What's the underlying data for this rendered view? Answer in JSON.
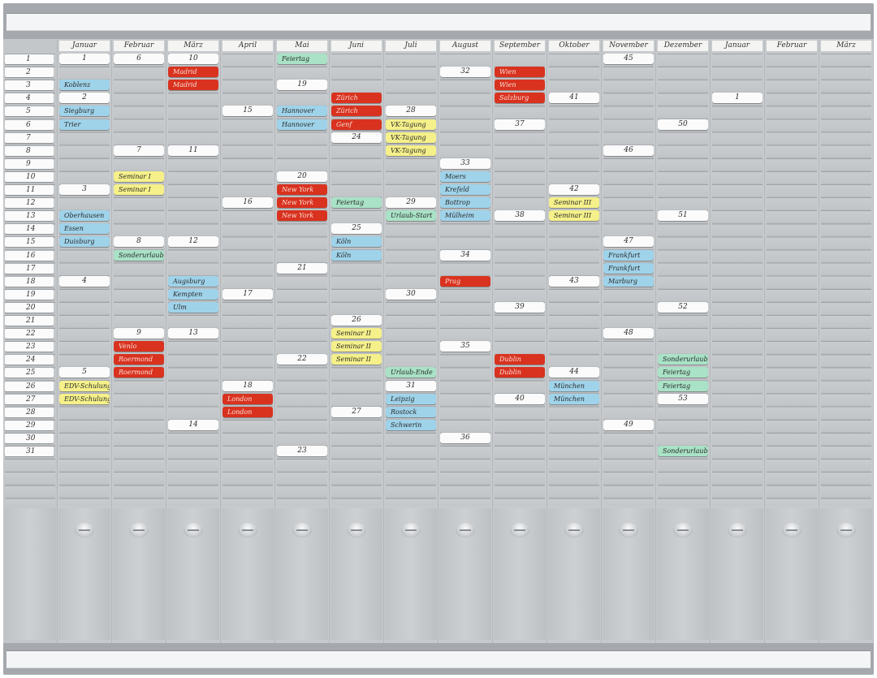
{
  "board": {
    "months": [
      "Januar",
      "Februar",
      "März",
      "April",
      "Mai",
      "Juni",
      "Juli",
      "August",
      "September",
      "Oktober",
      "November",
      "Dezember",
      "Januar",
      "Februar",
      "März"
    ],
    "days": [
      "1",
      "2",
      "3",
      "4",
      "5",
      "6",
      "7",
      "8",
      "9",
      "10",
      "11",
      "12",
      "13",
      "14",
      "15",
      "16",
      "17",
      "18",
      "19",
      "20",
      "21",
      "22",
      "23",
      "24",
      "25",
      "26",
      "27",
      "28",
      "29",
      "30",
      "31"
    ]
  },
  "colors": {
    "white": "#fbfbfb",
    "blue": "#9fd3ea",
    "red": "#d9321f",
    "yellow": "#f5f08a",
    "green": "#a9e2c6"
  },
  "cards": [
    {
      "m": 0,
      "d": 1,
      "t": "1",
      "c": "white",
      "num": true
    },
    {
      "m": 0,
      "d": 3,
      "t": "Koblenz",
      "c": "blue"
    },
    {
      "m": 0,
      "d": 4,
      "t": "2",
      "c": "white",
      "num": true
    },
    {
      "m": 0,
      "d": 5,
      "t": "Siegburg",
      "c": "blue"
    },
    {
      "m": 0,
      "d": 6,
      "t": "Trier",
      "c": "blue"
    },
    {
      "m": 0,
      "d": 11,
      "t": "3",
      "c": "white",
      "num": true
    },
    {
      "m": 0,
      "d": 13,
      "t": "Oberhausen",
      "c": "blue"
    },
    {
      "m": 0,
      "d": 14,
      "t": "Essen",
      "c": "blue"
    },
    {
      "m": 0,
      "d": 15,
      "t": "Duisburg",
      "c": "blue"
    },
    {
      "m": 0,
      "d": 18,
      "t": "4",
      "c": "white",
      "num": true
    },
    {
      "m": 0,
      "d": 25,
      "t": "5",
      "c": "white",
      "num": true
    },
    {
      "m": 0,
      "d": 26,
      "t": "EDV-Schulung",
      "c": "yellow"
    },
    {
      "m": 0,
      "d": 27,
      "t": "EDV-Schulung",
      "c": "yellow"
    },
    {
      "m": 1,
      "d": 1,
      "t": "6",
      "c": "white",
      "num": true
    },
    {
      "m": 1,
      "d": 8,
      "t": "7",
      "c": "white",
      "num": true
    },
    {
      "m": 1,
      "d": 10,
      "t": "Seminar I",
      "c": "yellow"
    },
    {
      "m": 1,
      "d": 11,
      "t": "Seminar I",
      "c": "yellow"
    },
    {
      "m": 1,
      "d": 15,
      "t": "8",
      "c": "white",
      "num": true
    },
    {
      "m": 1,
      "d": 16,
      "t": "Sonderurlaub",
      "c": "green"
    },
    {
      "m": 1,
      "d": 22,
      "t": "9",
      "c": "white",
      "num": true
    },
    {
      "m": 1,
      "d": 23,
      "t": "Venlo",
      "c": "red"
    },
    {
      "m": 1,
      "d": 24,
      "t": "Roermond",
      "c": "red"
    },
    {
      "m": 1,
      "d": 25,
      "t": "Roermond",
      "c": "red"
    },
    {
      "m": 2,
      "d": 1,
      "t": "10",
      "c": "white",
      "num": true
    },
    {
      "m": 2,
      "d": 2,
      "t": "Madrid",
      "c": "red"
    },
    {
      "m": 2,
      "d": 3,
      "t": "Madrid",
      "c": "red"
    },
    {
      "m": 2,
      "d": 8,
      "t": "11",
      "c": "white",
      "num": true
    },
    {
      "m": 2,
      "d": 15,
      "t": "12",
      "c": "white",
      "num": true
    },
    {
      "m": 2,
      "d": 18,
      "t": "Augsburg",
      "c": "blue"
    },
    {
      "m": 2,
      "d": 19,
      "t": "Kempten",
      "c": "blue"
    },
    {
      "m": 2,
      "d": 20,
      "t": "Ulm",
      "c": "blue"
    },
    {
      "m": 2,
      "d": 22,
      "t": "13",
      "c": "white",
      "num": true
    },
    {
      "m": 2,
      "d": 29,
      "t": "14",
      "c": "white",
      "num": true
    },
    {
      "m": 3,
      "d": 5,
      "t": "15",
      "c": "white",
      "num": true
    },
    {
      "m": 3,
      "d": 12,
      "t": "16",
      "c": "white",
      "num": true
    },
    {
      "m": 3,
      "d": 19,
      "t": "17",
      "c": "white",
      "num": true
    },
    {
      "m": 3,
      "d": 26,
      "t": "18",
      "c": "white",
      "num": true
    },
    {
      "m": 3,
      "d": 27,
      "t": "London",
      "c": "red"
    },
    {
      "m": 3,
      "d": 28,
      "t": "London",
      "c": "red"
    },
    {
      "m": 4,
      "d": 1,
      "t": "Feiertag",
      "c": "green"
    },
    {
      "m": 4,
      "d": 3,
      "t": "19",
      "c": "white",
      "num": true
    },
    {
      "m": 4,
      "d": 5,
      "t": "Hannover",
      "c": "blue"
    },
    {
      "m": 4,
      "d": 6,
      "t": "Hannover",
      "c": "blue"
    },
    {
      "m": 4,
      "d": 10,
      "t": "20",
      "c": "white",
      "num": true
    },
    {
      "m": 4,
      "d": 11,
      "t": "New York",
      "c": "red"
    },
    {
      "m": 4,
      "d": 12,
      "t": "New York",
      "c": "red"
    },
    {
      "m": 4,
      "d": 13,
      "t": "New York",
      "c": "red"
    },
    {
      "m": 4,
      "d": 17,
      "t": "21",
      "c": "white",
      "num": true
    },
    {
      "m": 4,
      "d": 24,
      "t": "22",
      "c": "white",
      "num": true
    },
    {
      "m": 4,
      "d": 31,
      "t": "23",
      "c": "white",
      "num": true
    },
    {
      "m": 5,
      "d": 4,
      "t": "Zürich",
      "c": "red"
    },
    {
      "m": 5,
      "d": 5,
      "t": "Zürich",
      "c": "red"
    },
    {
      "m": 5,
      "d": 6,
      "t": "Genf",
      "c": "red"
    },
    {
      "m": 5,
      "d": 7,
      "t": "24",
      "c": "white",
      "num": true
    },
    {
      "m": 5,
      "d": 12,
      "t": "Feiertag",
      "c": "green"
    },
    {
      "m": 5,
      "d": 14,
      "t": "25",
      "c": "white",
      "num": true
    },
    {
      "m": 5,
      "d": 15,
      "t": "Köln",
      "c": "blue"
    },
    {
      "m": 5,
      "d": 16,
      "t": "Köln",
      "c": "blue"
    },
    {
      "m": 5,
      "d": 21,
      "t": "26",
      "c": "white",
      "num": true
    },
    {
      "m": 5,
      "d": 22,
      "t": "Seminar II",
      "c": "yellow"
    },
    {
      "m": 5,
      "d": 23,
      "t": "Seminar II",
      "c": "yellow"
    },
    {
      "m": 5,
      "d": 24,
      "t": "Seminar II",
      "c": "yellow"
    },
    {
      "m": 5,
      "d": 28,
      "t": "27",
      "c": "white",
      "num": true
    },
    {
      "m": 6,
      "d": 5,
      "t": "28",
      "c": "white",
      "num": true
    },
    {
      "m": 6,
      "d": 6,
      "t": "VK-Tagung",
      "c": "yellow"
    },
    {
      "m": 6,
      "d": 7,
      "t": "VK-Tagung",
      "c": "yellow"
    },
    {
      "m": 6,
      "d": 8,
      "t": "VK-Tagung",
      "c": "yellow"
    },
    {
      "m": 6,
      "d": 12,
      "t": "29",
      "c": "white",
      "num": true
    },
    {
      "m": 6,
      "d": 13,
      "t": "Urlaub-Start",
      "c": "green"
    },
    {
      "m": 6,
      "d": 19,
      "t": "30",
      "c": "white",
      "num": true
    },
    {
      "m": 6,
      "d": 25,
      "t": "Urlaub-Ende",
      "c": "green"
    },
    {
      "m": 6,
      "d": 26,
      "t": "31",
      "c": "white",
      "num": true
    },
    {
      "m": 6,
      "d": 27,
      "t": "Leipzig",
      "c": "blue"
    },
    {
      "m": 6,
      "d": 28,
      "t": "Rostock",
      "c": "blue"
    },
    {
      "m": 6,
      "d": 29,
      "t": "Schwerin",
      "c": "blue"
    },
    {
      "m": 7,
      "d": 2,
      "t": "32",
      "c": "white",
      "num": true
    },
    {
      "m": 7,
      "d": 9,
      "t": "33",
      "c": "white",
      "num": true
    },
    {
      "m": 7,
      "d": 10,
      "t": "Moers",
      "c": "blue"
    },
    {
      "m": 7,
      "d": 11,
      "t": "Krefeld",
      "c": "blue"
    },
    {
      "m": 7,
      "d": 12,
      "t": "Bottrop",
      "c": "blue"
    },
    {
      "m": 7,
      "d": 13,
      "t": "Mülheim",
      "c": "blue"
    },
    {
      "m": 7,
      "d": 16,
      "t": "34",
      "c": "white",
      "num": true
    },
    {
      "m": 7,
      "d": 18,
      "t": "Prag",
      "c": "red"
    },
    {
      "m": 7,
      "d": 23,
      "t": "35",
      "c": "white",
      "num": true
    },
    {
      "m": 7,
      "d": 30,
      "t": "36",
      "c": "white",
      "num": true
    },
    {
      "m": 8,
      "d": 2,
      "t": "Wien",
      "c": "red"
    },
    {
      "m": 8,
      "d": 3,
      "t": "Wien",
      "c": "red"
    },
    {
      "m": 8,
      "d": 4,
      "t": "Salzburg",
      "c": "red"
    },
    {
      "m": 8,
      "d": 6,
      "t": "37",
      "c": "white",
      "num": true
    },
    {
      "m": 8,
      "d": 13,
      "t": "38",
      "c": "white",
      "num": true
    },
    {
      "m": 8,
      "d": 20,
      "t": "39",
      "c": "white",
      "num": true
    },
    {
      "m": 8,
      "d": 24,
      "t": "Dublin",
      "c": "red"
    },
    {
      "m": 8,
      "d": 25,
      "t": "Dublin",
      "c": "red"
    },
    {
      "m": 8,
      "d": 27,
      "t": "40",
      "c": "white",
      "num": true
    },
    {
      "m": 9,
      "d": 4,
      "t": "41",
      "c": "white",
      "num": true
    },
    {
      "m": 9,
      "d": 11,
      "t": "42",
      "c": "white",
      "num": true
    },
    {
      "m": 9,
      "d": 12,
      "t": "Seminar III",
      "c": "yellow"
    },
    {
      "m": 9,
      "d": 13,
      "t": "Seminar III",
      "c": "yellow"
    },
    {
      "m": 9,
      "d": 18,
      "t": "43",
      "c": "white",
      "num": true
    },
    {
      "m": 9,
      "d": 25,
      "t": "44",
      "c": "white",
      "num": true
    },
    {
      "m": 9,
      "d": 26,
      "t": "München",
      "c": "blue"
    },
    {
      "m": 9,
      "d": 27,
      "t": "München",
      "c": "blue"
    },
    {
      "m": 10,
      "d": 1,
      "t": "45",
      "c": "white",
      "num": true
    },
    {
      "m": 10,
      "d": 8,
      "t": "46",
      "c": "white",
      "num": true
    },
    {
      "m": 10,
      "d": 15,
      "t": "47",
      "c": "white",
      "num": true
    },
    {
      "m": 10,
      "d": 16,
      "t": "Frankfurt",
      "c": "blue"
    },
    {
      "m": 10,
      "d": 17,
      "t": "Frankfurt",
      "c": "blue"
    },
    {
      "m": 10,
      "d": 18,
      "t": "Marburg",
      "c": "blue"
    },
    {
      "m": 10,
      "d": 22,
      "t": "48",
      "c": "white",
      "num": true
    },
    {
      "m": 10,
      "d": 29,
      "t": "49",
      "c": "white",
      "num": true
    },
    {
      "m": 11,
      "d": 6,
      "t": "50",
      "c": "white",
      "num": true
    },
    {
      "m": 11,
      "d": 13,
      "t": "51",
      "c": "white",
      "num": true
    },
    {
      "m": 11,
      "d": 20,
      "t": "52",
      "c": "white",
      "num": true
    },
    {
      "m": 11,
      "d": 24,
      "t": "Sonderurlaub",
      "c": "green"
    },
    {
      "m": 11,
      "d": 25,
      "t": "Feiertag",
      "c": "green"
    },
    {
      "m": 11,
      "d": 26,
      "t": "Feiertag",
      "c": "green"
    },
    {
      "m": 11,
      "d": 27,
      "t": "53",
      "c": "white",
      "num": true
    },
    {
      "m": 11,
      "d": 31,
      "t": "Sonderurlaub",
      "c": "green"
    },
    {
      "m": 12,
      "d": 4,
      "t": "1",
      "c": "white",
      "num": true
    }
  ]
}
